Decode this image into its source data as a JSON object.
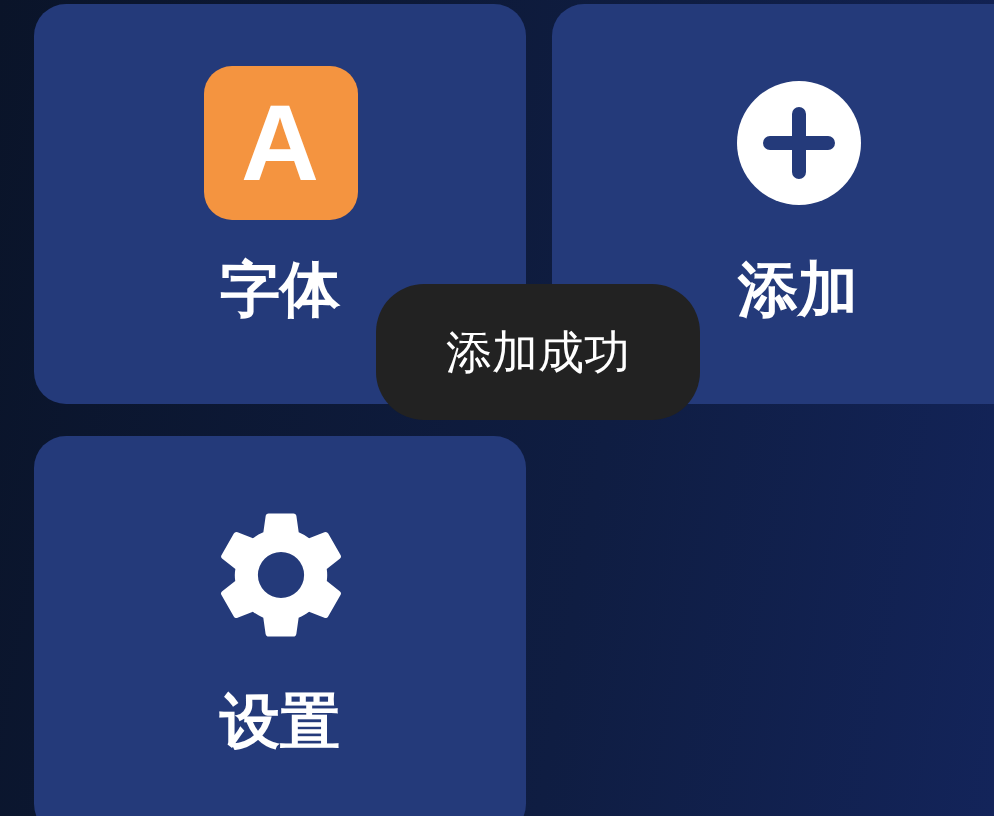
{
  "tiles": [
    {
      "kind": "font",
      "label": "字体",
      "glyph": "A"
    },
    {
      "kind": "add",
      "label": "添加"
    },
    {
      "kind": "settings",
      "label": "设置"
    }
  ],
  "toast": {
    "text": "添加成功"
  }
}
